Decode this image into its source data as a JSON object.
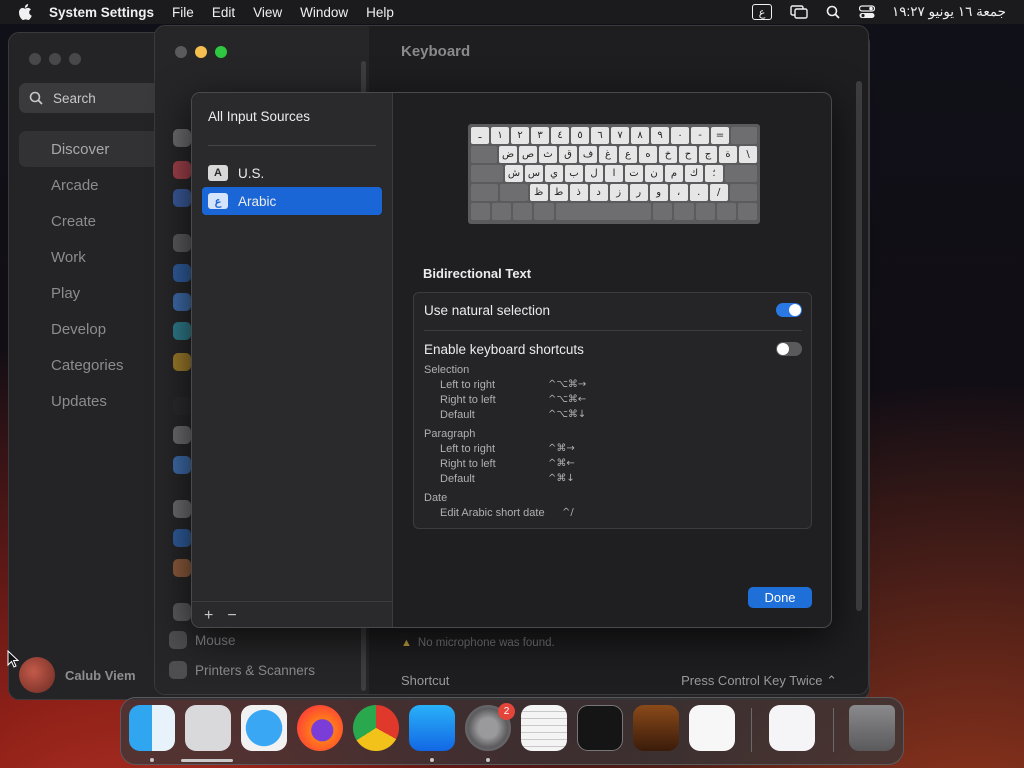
{
  "menubar": {
    "app": "System Settings",
    "menus": [
      "File",
      "Edit",
      "View",
      "Window",
      "Help"
    ],
    "input_badge": "ع",
    "clock": "جمعة ١٦ يونيو ١٩:٢٧"
  },
  "app_store": {
    "search_label": "Search",
    "nav": [
      "Discover",
      "Arcade",
      "Create",
      "Work",
      "Play",
      "Develop",
      "Categories",
      "Updates"
    ],
    "selected": "Discover",
    "user_name": "Calub Viem"
  },
  "settings": {
    "title": "Keyboard",
    "sidebar_bottom": [
      "Mouse",
      "Printers & Scanners"
    ],
    "mic_warning": "No microphone was found.",
    "shortcut_label": "Shortcut",
    "shortcut_value": "Press Control Key Twice"
  },
  "sheet": {
    "header": "All Input Sources",
    "sources": [
      {
        "badge": "A",
        "name": "U.S.",
        "selected": false
      },
      {
        "badge": "ع",
        "name": "Arabic",
        "selected": true
      }
    ],
    "add_label": "+",
    "remove_label": "−",
    "keyboard_rows": [
      [
        "ـ",
        "١",
        "٢",
        "٣",
        "٤",
        "٥",
        "٦",
        "٧",
        "٨",
        "٩",
        "٠",
        "-",
        "="
      ],
      [
        "ض",
        "ص",
        "ث",
        "ق",
        "ف",
        "غ",
        "ع",
        "ه",
        "خ",
        "ح",
        "ج",
        "ة",
        "\\"
      ],
      [
        "ش",
        "س",
        "ي",
        "ب",
        "ل",
        "ا",
        "ت",
        "ن",
        "م",
        "ك",
        "؛"
      ],
      [
        "ظ",
        "ط",
        "ذ",
        "د",
        "ز",
        "ر",
        "و",
        "،",
        ".",
        "/"
      ]
    ],
    "section_title": "Bidirectional Text",
    "natural_selection_label": "Use natural selection",
    "natural_selection_on": true,
    "shortcuts_label": "Enable keyboard shortcuts",
    "shortcuts_on": false,
    "shortcut_groups": [
      {
        "heading": "Selection",
        "items": [
          {
            "label": "Left to right",
            "keys": "^⌥⌘→"
          },
          {
            "label": "Right to left",
            "keys": "^⌥⌘←"
          },
          {
            "label": "Default",
            "keys": "^⌥⌘↓"
          }
        ]
      },
      {
        "heading": "Paragraph",
        "items": [
          {
            "label": "Left to right",
            "keys": "^⌘→"
          },
          {
            "label": "Right to left",
            "keys": "^⌘←"
          },
          {
            "label": "Default",
            "keys": "^⌘↓"
          }
        ]
      },
      {
        "heading": "Date",
        "items": [
          {
            "label": "Edit Arabic short date",
            "keys": "^/"
          }
        ]
      }
    ],
    "done_label": "Done"
  },
  "dock": {
    "apps": [
      "finder-icon",
      "launchpad-icon",
      "safari-icon",
      "firefox-icon",
      "chrome-icon",
      "app-store-icon",
      "system-settings-icon",
      "textedit-icon",
      "terminal-icon",
      "garageband-icon",
      "vscode-icon",
      "visual-studio-icon",
      "trash-icon"
    ],
    "settings_badge": "2"
  }
}
